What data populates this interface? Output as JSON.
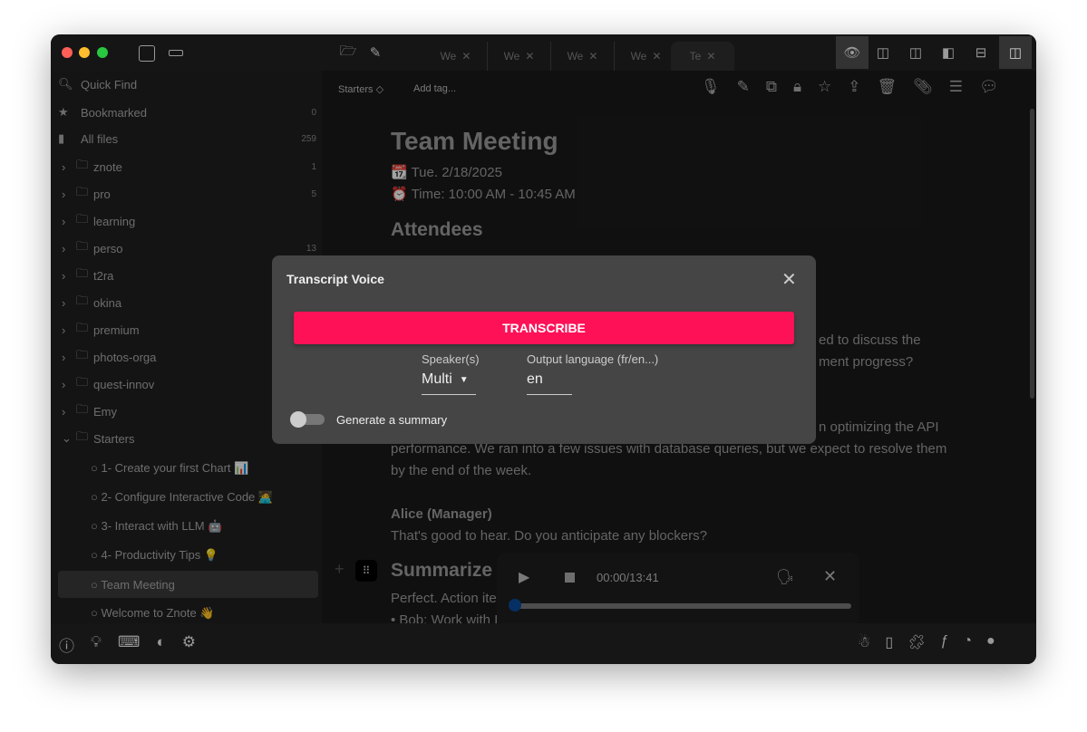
{
  "titlebar": {
    "tabs": [
      {
        "label": "We"
      },
      {
        "label": "We"
      },
      {
        "label": "We"
      },
      {
        "label": "We"
      },
      {
        "label": "Te"
      }
    ]
  },
  "sidebar": {
    "quick_find": "Quick Find",
    "bookmarked": {
      "label": "Bookmarked",
      "count": "0"
    },
    "all_files": {
      "label": "All files",
      "count": "259"
    },
    "folders": [
      {
        "label": "znote",
        "count": "1"
      },
      {
        "label": "pro",
        "count": "5"
      },
      {
        "label": "learning",
        "count": ""
      },
      {
        "label": "perso",
        "count": "13"
      },
      {
        "label": "t2ra",
        "count": ""
      },
      {
        "label": "okina",
        "count": ""
      },
      {
        "label": "premium",
        "count": ""
      },
      {
        "label": "photos-orga",
        "count": ""
      },
      {
        "label": "quest-innov",
        "count": ""
      },
      {
        "label": "Emy",
        "count": ""
      },
      {
        "label": "Starters",
        "count": ""
      }
    ],
    "notes": [
      {
        "label": "○ 1- Create your first Chart 📊"
      },
      {
        "label": "○ 2- Configure Interactive Code 🧑‍💻"
      },
      {
        "label": "○ 3- Interact with LLM 🤖"
      },
      {
        "label": "○ 4- Productivity Tips 💡"
      },
      {
        "label": "○ Team Meeting"
      },
      {
        "label": "○ Welcome to Znote 👋"
      }
    ]
  },
  "toolbar": {
    "folder": "Starters ◇",
    "add_tag": "Add tag..."
  },
  "doc": {
    "title": "Team Meeting",
    "date": "📆 Tue. 2/18/2025",
    "time": "⏰ Time: 10:00 AM - 10:45 AM",
    "h_attendees": "Attendees",
    "frag1": "ed to discuss the",
    "frag2": "ment progress?",
    "frag3": "n optimizing the API",
    "p2": "performance. We ran into a few issues with database queries, but we expect to resolve them",
    "p3": "by the end of the week.",
    "speaker": "Alice (Manager)",
    "p4": "That's good to hear. Do you anticipate any blockers?",
    "h_summarize": "Summarize",
    "p5": "Perfect. Action ite",
    "p6": "• Bob: Work with I"
  },
  "modal": {
    "title": "Transcript Voice",
    "transcribe": "TRANSCRIBE",
    "speakers_label": "Speaker(s)",
    "speakers_value": "Multi",
    "lang_label": "Output language (fr/en...)",
    "lang_value": "en",
    "summary_label": "Generate a summary",
    "summary_enabled": false
  },
  "player": {
    "time": "00:00/13:41",
    "progress": 0
  },
  "colors": {
    "accent": "#ff1158",
    "progress_knob": "#0a4a9a"
  }
}
